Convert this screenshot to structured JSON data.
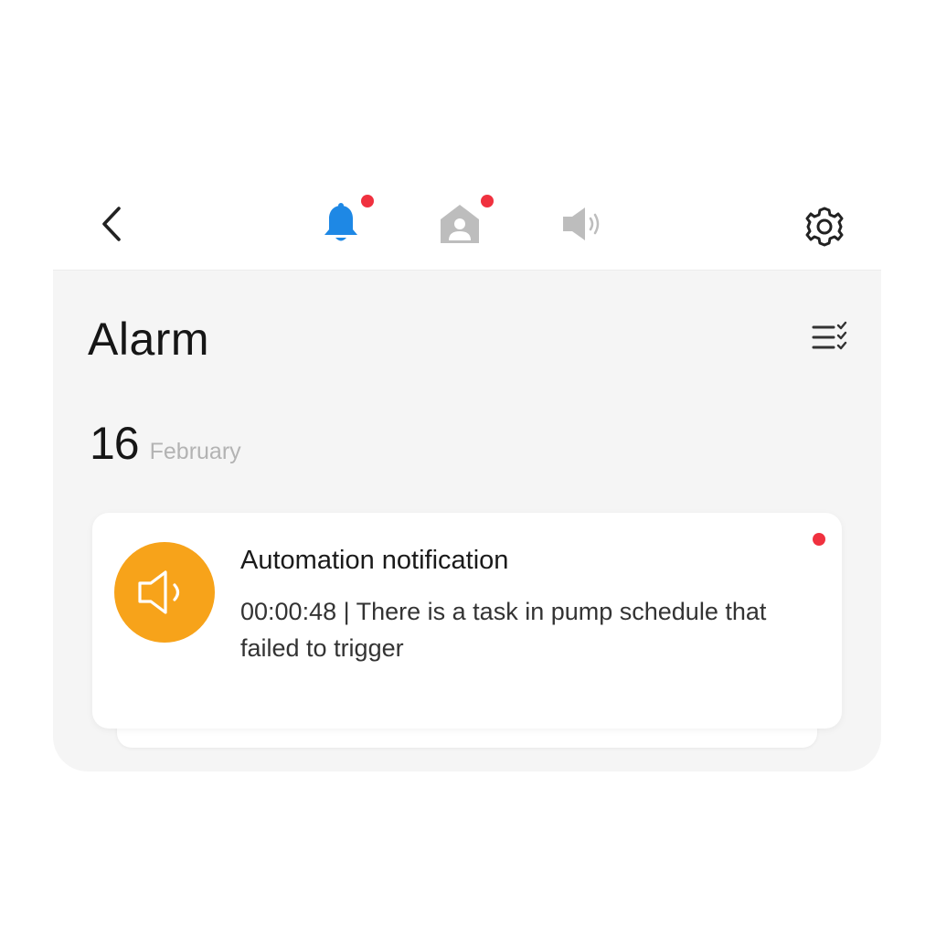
{
  "header": {
    "tabs": [
      {
        "name": "alarm",
        "icon": "bell-icon",
        "active": true,
        "unread": true,
        "color": "#1e88e5"
      },
      {
        "name": "home",
        "icon": "home-person-icon",
        "active": false,
        "unread": true,
        "color": "#bdbdbd"
      },
      {
        "name": "notification",
        "icon": "speaker-icon",
        "active": false,
        "unread": false,
        "color": "#bdbdbd"
      }
    ],
    "back_icon": "chevron-left-icon",
    "settings_icon": "gear-icon"
  },
  "main": {
    "title": "Alarm",
    "mark_all_icon": "list-check-icon",
    "groups": [
      {
        "day": "16",
        "month": "February",
        "messages": [
          {
            "icon": "speaker-icon",
            "icon_color": "#f7a31a",
            "title": "Automation notification",
            "body": "00:00:48 | There is a task in pump schedule that failed to trigger",
            "unread": true
          }
        ]
      }
    ]
  },
  "colors": {
    "accent": "#1e88e5",
    "badge": "#f0313f",
    "panel_bg": "#f5f5f5"
  }
}
